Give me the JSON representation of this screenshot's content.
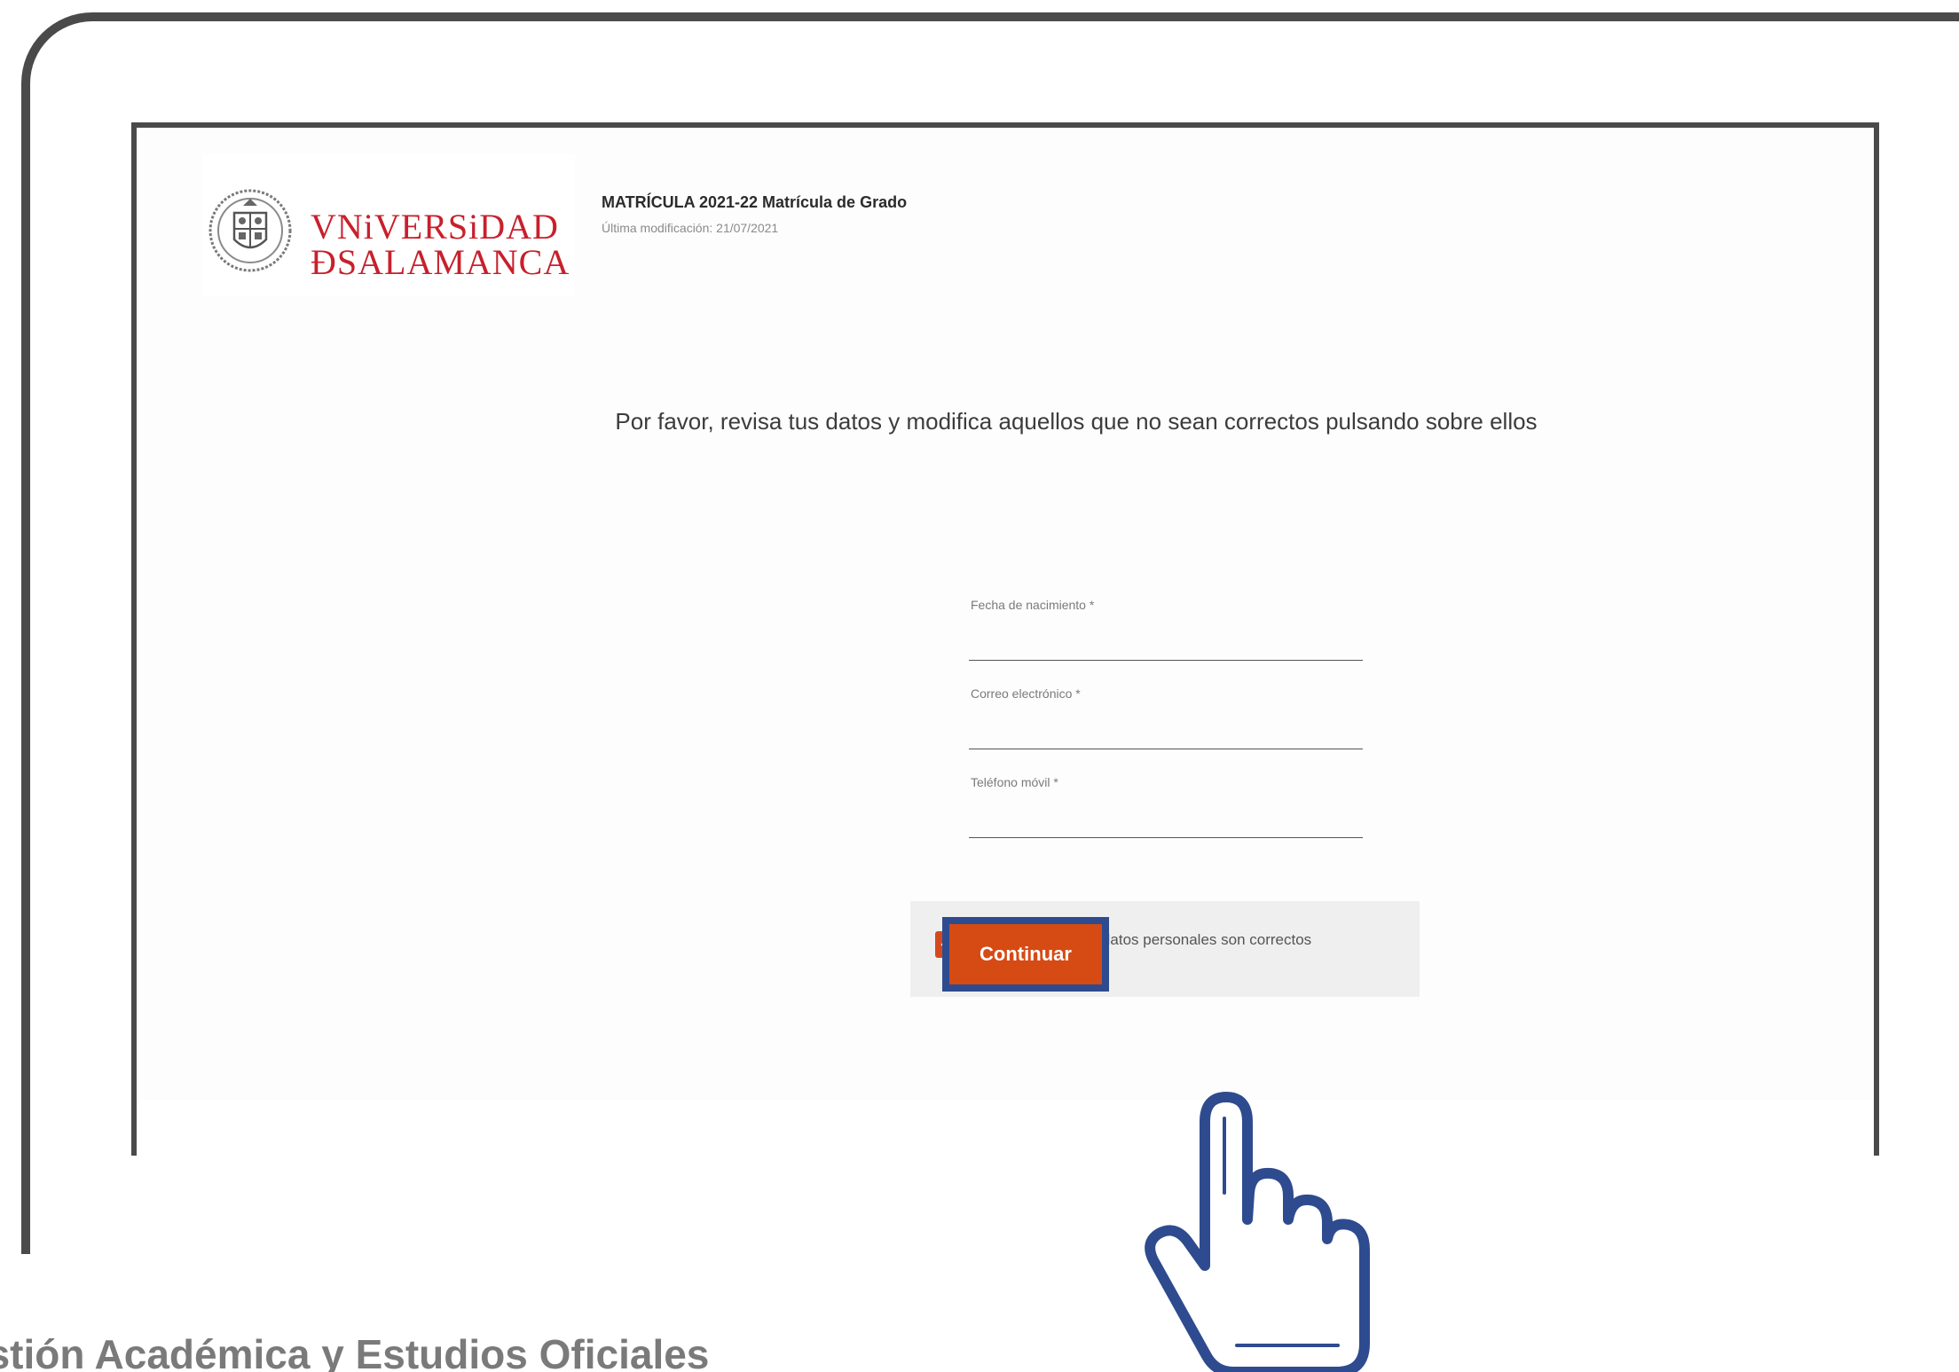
{
  "header": {
    "logo_line1": "VNiVERSiDAD",
    "logo_line2": "ÐSALAMANCA",
    "title": "MATRÍCULA 2021-22 Matrícula de Grado",
    "subtitle": "Última modificación: 21/07/2021"
  },
  "main": {
    "instruction": "Por favor, revisa tus datos y modifica aquellos que no sean correctos pulsando sobre ellos",
    "fields": [
      {
        "label": "Fecha de nacimiento *",
        "value": ""
      },
      {
        "label": "Correo electrónico *",
        "value": ""
      },
      {
        "label": "Teléfono móvil *",
        "value": ""
      }
    ],
    "confirm": {
      "label": "Confirmo que mis datos personales son correctos",
      "checked": true
    },
    "continue_label": "Continuar"
  },
  "footer": {
    "text": "estión Académica y Estudios Oficiales"
  },
  "icons": {
    "seal": "university-seal-icon",
    "check": "checkmark-icon",
    "pointer": "hand-pointer-icon"
  },
  "colors": {
    "brand_red": "#c8202c",
    "accent_orange": "#d64a14",
    "highlight_blue": "#2e4b8f",
    "frame_gray": "#4a4a4a"
  }
}
